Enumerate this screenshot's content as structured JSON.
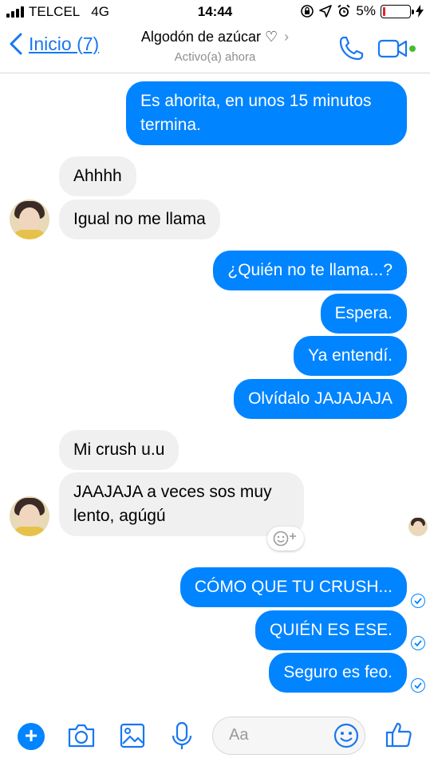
{
  "status": {
    "carrier": "TELCEL",
    "network": "4G",
    "time": "14:44",
    "battery_percent": "5%",
    "battery_level": 0.05,
    "battery_color": "#e0262a"
  },
  "header": {
    "back_label": "Inicio (7)",
    "contact_name": "Algodón de azúcar ♡",
    "chevron": "›",
    "status": "Activo(a) ahora",
    "accent": "#1877f2",
    "active_dot_color": "#44bd32"
  },
  "messages": [
    {
      "side": "out",
      "text1": "Es ahorita, en unos 15 minutos",
      "text2": "termina."
    },
    {
      "side": "in",
      "text": "Ahhhh"
    },
    {
      "side": "in",
      "text": "Igual no me llama"
    },
    {
      "side": "out",
      "text": "¿Quién no te llama...?"
    },
    {
      "side": "out",
      "text": "Espera."
    },
    {
      "side": "out",
      "text": "Ya entendí."
    },
    {
      "side": "out",
      "text": "Olvídalo JAJAJAJA"
    },
    {
      "side": "in",
      "text": "Mi crush u.u"
    },
    {
      "side": "in",
      "text1": "JAAJAJA a veces sos muy",
      "text2": "lento, agúgú"
    },
    {
      "side": "out",
      "text": "CÓMO QUE TU CRUSH..."
    },
    {
      "side": "out",
      "text": "QUIÉN ES ESE."
    },
    {
      "side": "out",
      "text": "Seguro es feo."
    }
  ],
  "composer": {
    "placeholder": "Aa",
    "icons": [
      "plus-icon",
      "camera-icon",
      "gallery-icon",
      "microphone-icon",
      "emoji-icon",
      "thumbs-up-icon"
    ]
  },
  "colors": {
    "outgoing_bubble": "#0084ff",
    "incoming_bubble": "#f1f0f0"
  }
}
